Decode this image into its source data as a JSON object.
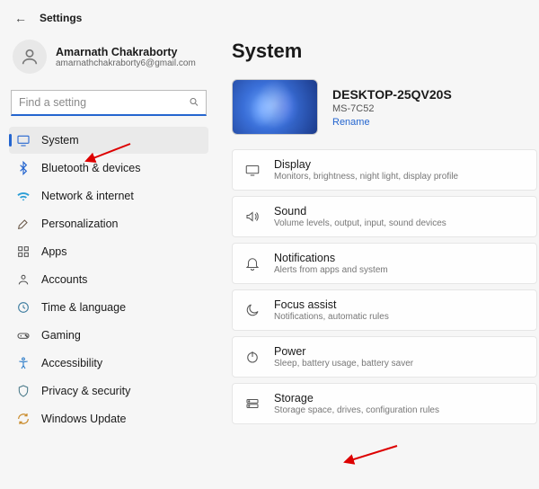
{
  "window": {
    "title": "Settings"
  },
  "profile": {
    "name": "Amarnath Chakraborty",
    "email": "amarnathchakraborty6@gmail.com"
  },
  "search": {
    "placeholder": "Find a setting"
  },
  "nav": {
    "items": [
      {
        "label": "System",
        "icon": "monitor",
        "selected": true
      },
      {
        "label": "Bluetooth & devices",
        "icon": "bluetooth"
      },
      {
        "label": "Network & internet",
        "icon": "wifi"
      },
      {
        "label": "Personalization",
        "icon": "brush"
      },
      {
        "label": "Apps",
        "icon": "apps"
      },
      {
        "label": "Accounts",
        "icon": "user"
      },
      {
        "label": "Time & language",
        "icon": "clock"
      },
      {
        "label": "Gaming",
        "icon": "gamepad"
      },
      {
        "label": "Accessibility",
        "icon": "accessibility"
      },
      {
        "label": "Privacy & security",
        "icon": "shield"
      },
      {
        "label": "Windows Update",
        "icon": "update"
      }
    ]
  },
  "page": {
    "heading": "System",
    "device": {
      "name": "DESKTOP-25QV20S",
      "model": "MS-7C52",
      "rename_label": "Rename"
    },
    "cards": [
      {
        "title": "Display",
        "sub": "Monitors, brightness, night light, display profile",
        "icon": "display"
      },
      {
        "title": "Sound",
        "sub": "Volume levels, output, input, sound devices",
        "icon": "sound"
      },
      {
        "title": "Notifications",
        "sub": "Alerts from apps and system",
        "icon": "bell"
      },
      {
        "title": "Focus assist",
        "sub": "Notifications, automatic rules",
        "icon": "moon"
      },
      {
        "title": "Power",
        "sub": "Sleep, battery usage, battery saver",
        "icon": "power"
      },
      {
        "title": "Storage",
        "sub": "Storage space, drives, configuration rules",
        "icon": "storage"
      }
    ]
  }
}
